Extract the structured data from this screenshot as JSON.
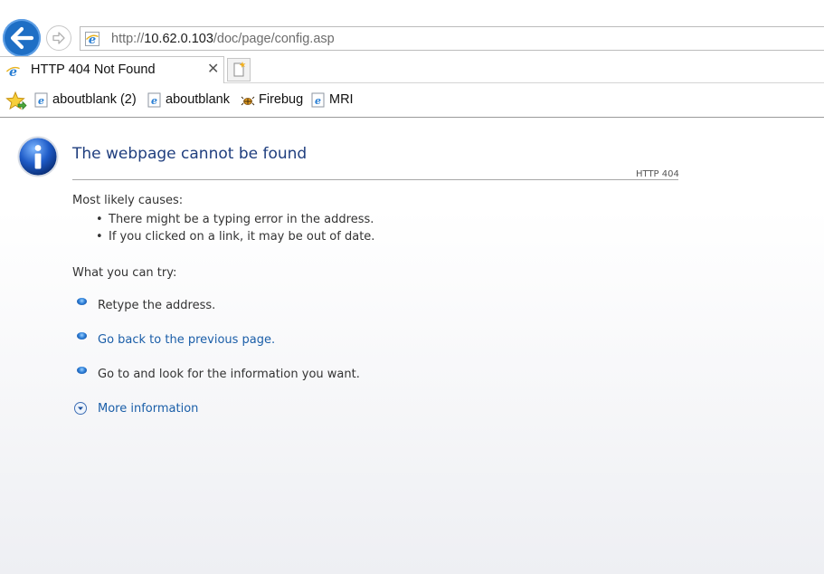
{
  "browser": {
    "address": {
      "scheme": "http://",
      "host": "10.62.0.103",
      "path": "/doc/page/config.asp"
    },
    "tab": {
      "title": "HTTP 404 Not Found",
      "close_glyph": "✕"
    },
    "favorites": [
      {
        "label": "aboutblank (2)",
        "icon": "ie-page-icon"
      },
      {
        "label": "aboutblank",
        "icon": "ie-page-icon"
      },
      {
        "label": "Firebug",
        "icon": "firebug-icon"
      },
      {
        "label": "MRI",
        "icon": "ie-page-icon"
      }
    ],
    "colors": {
      "back_button": "#1f6fc5",
      "title_text": "#1f3e7e",
      "link_text": "#1a5ea8"
    }
  },
  "error_page": {
    "title": "The webpage cannot be found",
    "code": "HTTP 404",
    "causes_heading": "Most likely causes:",
    "causes": [
      "There might be a typing error in the address.",
      "If you clicked on a link, it may be out of date."
    ],
    "try_heading": "What you can try:",
    "try_items": [
      {
        "text": "Retype the address.",
        "link": false
      },
      {
        "text": "Go back to the previous page.",
        "link": true
      },
      {
        "text": "Go to  and look for the information you want.",
        "link": false
      }
    ],
    "more_info": "More information"
  }
}
